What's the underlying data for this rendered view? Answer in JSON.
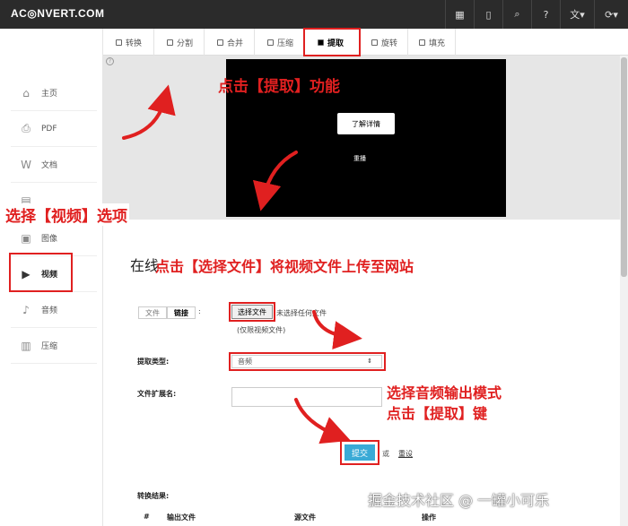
{
  "app": {
    "logo": "AC◎NVERT.COM"
  },
  "topbar_icons": [
    {
      "name": "grid-icon",
      "glyph": "▦"
    },
    {
      "name": "mobile-icon",
      "glyph": "▯"
    },
    {
      "name": "search-icon",
      "glyph": "⌕"
    },
    {
      "name": "help-icon",
      "glyph": "?"
    },
    {
      "name": "language-icon",
      "glyph": "文▾"
    },
    {
      "name": "refresh-icon",
      "glyph": "⟳▾"
    }
  ],
  "sidebar": {
    "items": [
      {
        "label": "主页",
        "icon": "home-icon",
        "glyph": "⌂"
      },
      {
        "label": "PDF",
        "icon": "pdf-icon",
        "glyph": "⎙"
      },
      {
        "label": "文档",
        "icon": "document-icon",
        "glyph": "W"
      },
      {
        "label": "",
        "icon": "ebook-icon",
        "glyph": "▤"
      },
      {
        "label": "图像",
        "icon": "image-icon",
        "glyph": "▣"
      },
      {
        "label": "视频",
        "icon": "video-icon",
        "glyph": "▶"
      },
      {
        "label": "音频",
        "icon": "audio-icon",
        "glyph": "♪"
      },
      {
        "label": "压缩",
        "icon": "archive-icon",
        "glyph": "▥"
      }
    ]
  },
  "tabs": [
    {
      "label": "转换"
    },
    {
      "label": "分割"
    },
    {
      "label": "合并"
    },
    {
      "label": "压缩"
    },
    {
      "label": "提取"
    },
    {
      "label": "旋转"
    },
    {
      "label": "填充"
    }
  ],
  "ad": {
    "button": "了解详情",
    "subtext": "重播"
  },
  "form": {
    "heading_prefix": "在线",
    "source_tab_file": "文件",
    "source_tab_link": "链接",
    "colon": ":",
    "choose_file": "选择文件",
    "no_file": "未选择任何文件",
    "video_only": "(仅限视频文件)",
    "extract_type_label": "提取类型:",
    "extract_type_value": "音频",
    "ext_label": "文件扩展名:",
    "submit": "提交",
    "or": "或",
    "reset": "重设",
    "results_label": "转换结果:",
    "table_headers": [
      "#",
      "输出文件",
      "源文件",
      "操作"
    ]
  },
  "annotations": {
    "click_extract": "点击【提取】功能",
    "select_video": "选择【视频】选项",
    "choose_file": "点击【选择文件】将视频文件上传至网站",
    "audio_mode_line1": "选择音频输出模式",
    "audio_mode_line2": "点击【提取】键"
  },
  "watermark": "掘金技术社区 @ 一罐小可乐",
  "colors": {
    "annotation_red": "#e02020",
    "submit_blue": "#3aaad6",
    "topbar": "#2b2b2b"
  }
}
